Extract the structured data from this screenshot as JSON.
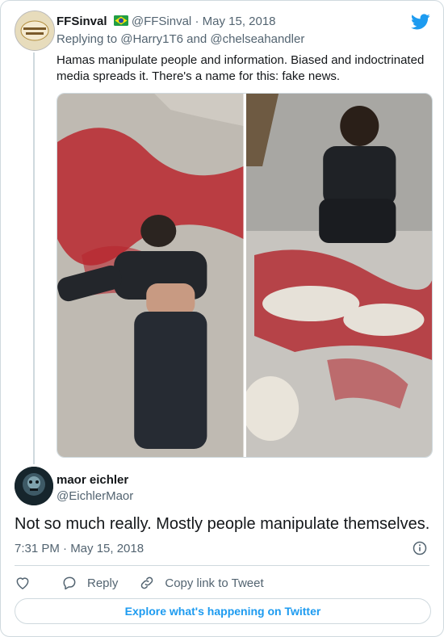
{
  "quoted_tweet": {
    "display_name": "FFSinval",
    "flag_icon": "brazil-flag-icon",
    "handle": "@FFSinval",
    "separator": "·",
    "date": "May 15, 2018",
    "replying_prefix": "Replying to",
    "replying_to_1": "@Harry1T6",
    "replying_and": "and",
    "replying_to_2": "@chelseahandler",
    "text": "Hamas manipulate people and information. Biased and indoctrinated media spreads it. There's a name for this: fake news."
  },
  "main_tweet": {
    "display_name": "maor eichler",
    "handle": "@EichlerMaor",
    "text": "Not so much really. Mostly people manipulate themselves.",
    "timestamp": "7:31 PM · May 15, 2018"
  },
  "actions": {
    "reply_label": "Reply",
    "copy_link_label": "Copy link to Tweet"
  },
  "explore_label": "Explore what's happening on Twitter",
  "colors": {
    "twitter_blue": "#1d9bf0",
    "text_primary": "#14171a",
    "text_secondary": "#536471",
    "border": "#cfd9de"
  }
}
